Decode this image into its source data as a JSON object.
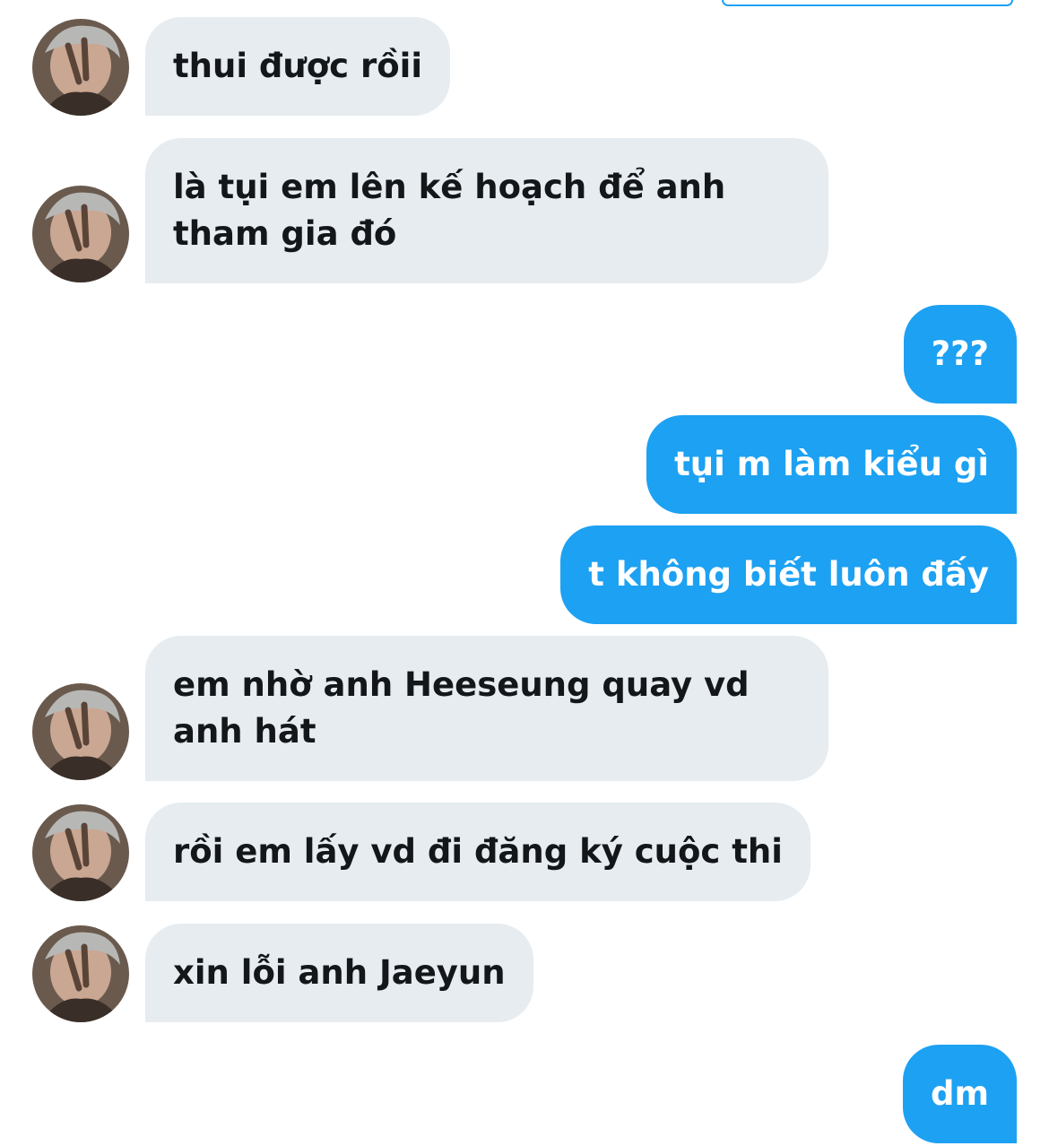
{
  "conversation": {
    "messages": [
      {
        "side": "in",
        "text": "thui được rồii"
      },
      {
        "side": "in",
        "text": "là tụi em lên kế hoạch để anh\ntham gia đó"
      },
      {
        "side": "out",
        "text": "???"
      },
      {
        "side": "out",
        "text": "tụi m làm kiểu gì"
      },
      {
        "side": "out",
        "text": "t không biết luôn đấy"
      },
      {
        "side": "in",
        "text": "em nhờ anh Heeseung quay vd\nanh hát"
      },
      {
        "side": "in",
        "text": "rồi em lấy vd đi đăng ký cuộc thi"
      },
      {
        "side": "in",
        "text": "xin lỗi anh Jaeyun"
      },
      {
        "side": "out",
        "text": "dm"
      }
    ]
  },
  "colors": {
    "incoming_bubble": "#e6ecf0",
    "outgoing_bubble": "#1da1f2",
    "incoming_text": "#14171a",
    "outgoing_text": "#ffffff",
    "background": "#ffffff"
  }
}
